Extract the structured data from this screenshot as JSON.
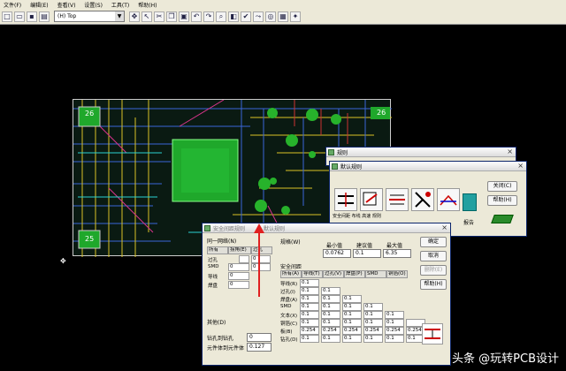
{
  "menu": [
    "文件(F)",
    "编辑(E)",
    "查看(V)",
    "设置(S)",
    "工具(T)",
    "帮助(H)"
  ],
  "toolbar": {
    "layer_value": "(H) Top",
    "arrow": "▼"
  },
  "board": {
    "labels": [
      "26",
      "25",
      "26"
    ]
  },
  "window_back": {
    "title": "规则"
  },
  "window_default": {
    "title": "默认规则",
    "close_button": "关闭(C)",
    "help_button": "帮助(H)",
    "report_label": "报告",
    "partial_labels": [
      "安全间距",
      "布线",
      "高速",
      "规则",
      "差分对"
    ]
  },
  "window_safety": {
    "title": "安全间距规则",
    "title_annotation": "默认规则",
    "same_net_group": "同一网络(N)",
    "same_net_headers": [
      "所有",
      "拐角(E)",
      "过孔"
    ],
    "same_net_rows": [
      {
        "label": "过孔",
        "values": [
          "",
          "0"
        ]
      },
      {
        "label": "SMD",
        "values": [
          "0",
          "0"
        ]
      },
      {
        "label": "导线",
        "values": [
          "0",
          ""
        ]
      },
      {
        "label": "焊盘",
        "values": [
          "0",
          ""
        ]
      }
    ],
    "spec_label": "规格(W)",
    "spec_headers": [
      "最小值",
      "建议值",
      "最大值"
    ],
    "spec_values": [
      "0.0762",
      "0.1",
      "6.35"
    ],
    "clearance_title": "安全间距",
    "clearance_headers": [
      "所有(A)",
      "导线(T)",
      "过孔(V)",
      "焊盘(P)",
      "SMD",
      "铜箔(O)"
    ],
    "clearance_rows": [
      {
        "label": "导线(R)",
        "values": [
          "0.1",
          "",
          "",
          "",
          "",
          ""
        ]
      },
      {
        "label": "过孔(I)",
        "values": [
          "0.1",
          "0.1",
          "",
          "",
          "",
          ""
        ]
      },
      {
        "label": "焊盘(A)",
        "values": [
          "0.1",
          "0.1",
          "0.1",
          "",
          "",
          ""
        ]
      },
      {
        "label": "SMD",
        "values": [
          "0.1",
          "0.1",
          "0.1",
          "0.1",
          "",
          ""
        ]
      },
      {
        "label": "文本(X)",
        "values": [
          "0.1",
          "0.1",
          "0.1",
          "0.1",
          "0.1",
          ""
        ]
      },
      {
        "label": "铜箔(C)",
        "values": [
          "0.1",
          "0.1",
          "0.1",
          "0.1",
          "0.1",
          ""
        ]
      },
      {
        "label": "板(B)",
        "values": [
          "0.254",
          "0.254",
          "0.254",
          "0.254",
          "0.254",
          "0.254"
        ]
      },
      {
        "label": "钻孔(D)",
        "values": [
          "0.1",
          "0.1",
          "0.1",
          "0.1",
          "0.1",
          "0.1"
        ]
      }
    ],
    "other_label": "其他(D)",
    "drill_to_drill_label": "钻孔到钻孔",
    "drill_to_drill_value": "0",
    "body_to_body_label": "元件体到元件体",
    "body_to_body_value": "0.127",
    "ok_button": "确定",
    "cancel_button": "取消",
    "delete_button": "删除(E)",
    "help_button": "帮助(H)"
  },
  "watermark": "头条 @玩转PCB设计",
  "colors": {
    "accent_red": "#e02020",
    "pcb_green": "#22aa30"
  }
}
